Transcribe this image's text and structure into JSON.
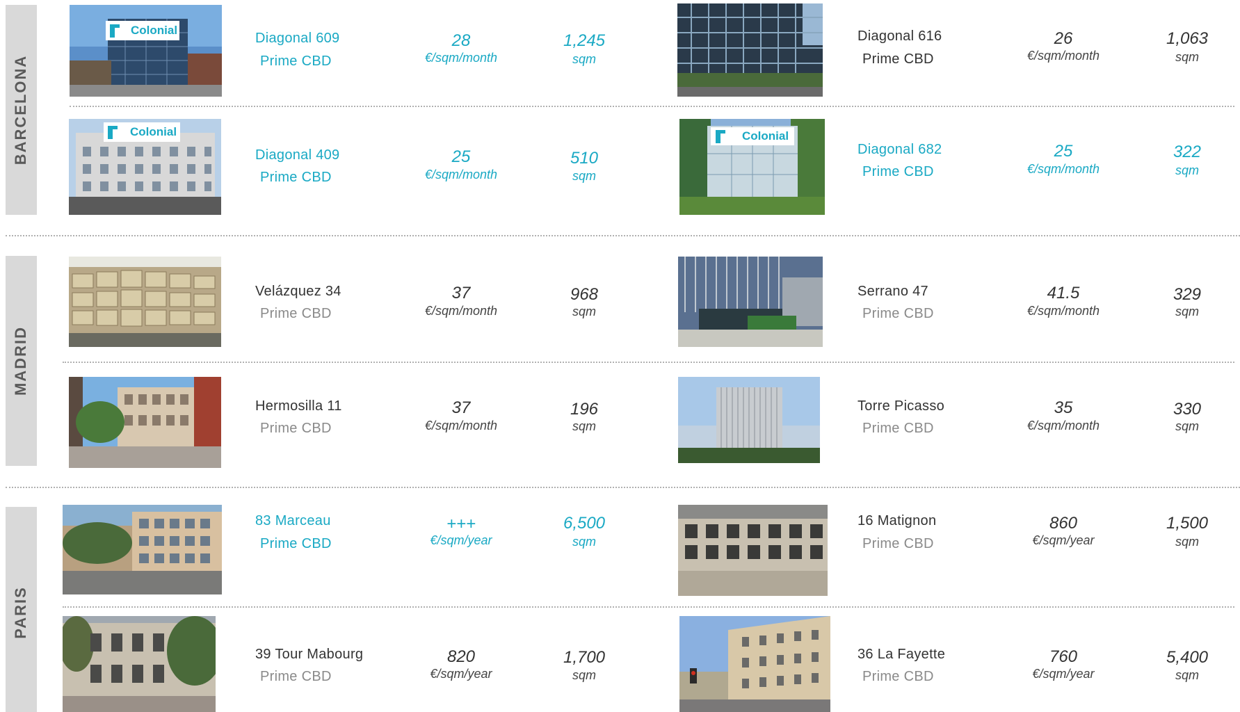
{
  "colors": {
    "highlight": "#1aa9c4",
    "text": "#333333",
    "subtext": "#8a8a8a",
    "tab": "#d9d9d9"
  },
  "cities": [
    "BARCELONA",
    "MADRID",
    "PARIS"
  ],
  "logo_text": "Colonial",
  "buildings": [
    {
      "name": "Diagonal 609",
      "zone": "Prime CBD",
      "rent": "28",
      "rent_unit": "€/sqm/month",
      "area": "1,245",
      "area_unit": "sqm"
    },
    {
      "name": "Diagonal 616",
      "zone": "Prime CBD",
      "rent": "26",
      "rent_unit": "€/sqm/month",
      "area": "1,063",
      "area_unit": "sqm"
    },
    {
      "name": "Diagonal 409",
      "zone": "Prime CBD",
      "rent": "25",
      "rent_unit": "€/sqm/month",
      "area": "510",
      "area_unit": "sqm"
    },
    {
      "name": "Diagonal 682",
      "zone": "Prime CBD",
      "rent": "25",
      "rent_unit": "€/sqm/month",
      "area": "322",
      "area_unit": "sqm"
    },
    {
      "name": "Velázquez 34",
      "zone": "Prime CBD",
      "rent": "37",
      "rent_unit": "€/sqm/month",
      "area": "968",
      "area_unit": "sqm"
    },
    {
      "name": "Serrano 47",
      "zone": "Prime CBD",
      "rent": "41.5",
      "rent_unit": "€/sqm/month",
      "area": "329",
      "area_unit": "sqm"
    },
    {
      "name": "Hermosilla 11",
      "zone": "Prime CBD",
      "rent": "37",
      "rent_unit": "€/sqm/month",
      "area": "196",
      "area_unit": "sqm"
    },
    {
      "name": "Torre Picasso",
      "zone": "Prime CBD",
      "rent": "35",
      "rent_unit": "€/sqm/month",
      "area": "330",
      "area_unit": "sqm"
    },
    {
      "name": "83 Marceau",
      "zone": "Prime CBD",
      "rent": "+++",
      "rent_unit": "€/sqm/year",
      "area": "6,500",
      "area_unit": "sqm"
    },
    {
      "name": "16 Matignon",
      "zone": "Prime CBD",
      "rent": "860",
      "rent_unit": "€/sqm/year",
      "area": "1,500",
      "area_unit": "sqm"
    },
    {
      "name": "39 Tour Mabourg",
      "zone": "Prime CBD",
      "rent": "820",
      "rent_unit": "€/sqm/year",
      "area": "1,700",
      "area_unit": "sqm"
    },
    {
      "name": "36 La Fayette",
      "zone": "Prime CBD",
      "rent": "760",
      "rent_unit": "€/sqm/year",
      "area": "5,400",
      "area_unit": "sqm"
    }
  ]
}
